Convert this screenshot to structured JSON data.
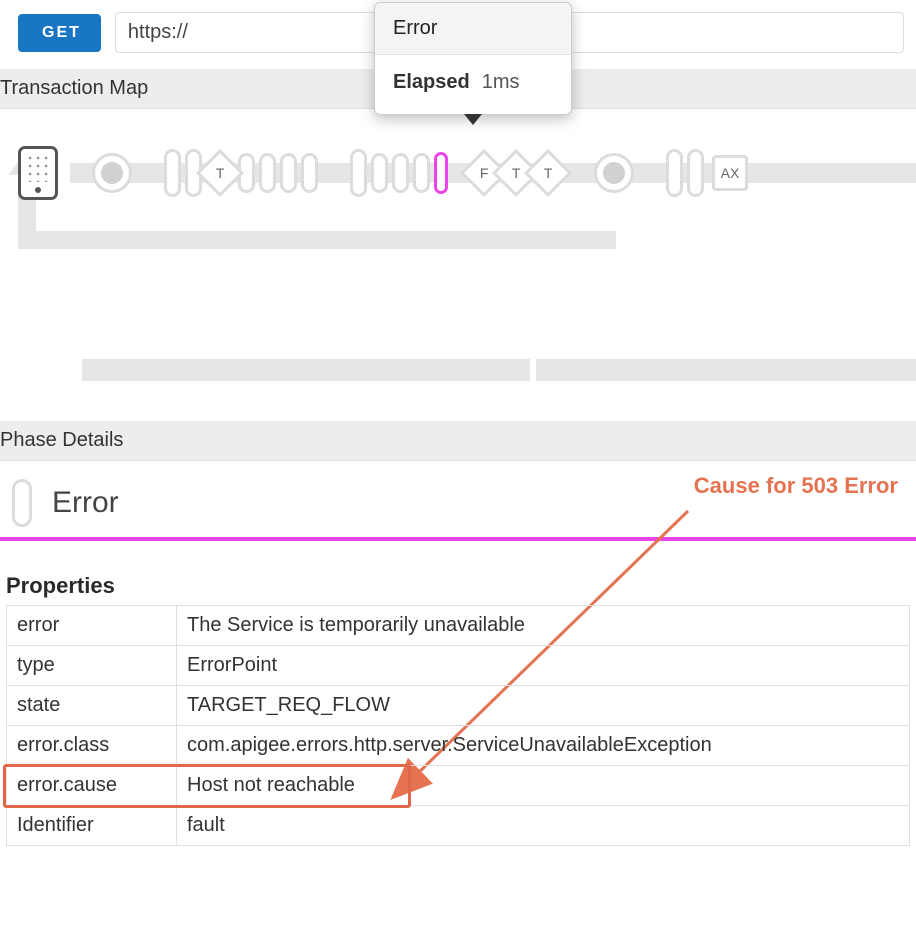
{
  "request": {
    "method": "GET",
    "url_prefix": "https://"
  },
  "tooltip": {
    "title": "Error",
    "label": "Elapsed",
    "value": "1ms"
  },
  "sections": {
    "transaction_map": "Transaction Map",
    "phase_details": "Phase Details"
  },
  "map": {
    "diamond1": "T",
    "diamond_f": "F",
    "diamond_t1": "T",
    "diamond_t2": "T",
    "box_ax": "AX"
  },
  "phase": {
    "title": "Error"
  },
  "annotation": "Cause for 503 Error",
  "properties_heading": "Properties",
  "properties": [
    {
      "k": "error",
      "v": "The Service is temporarily unavailable"
    },
    {
      "k": "type",
      "v": "ErrorPoint"
    },
    {
      "k": "state",
      "v": "TARGET_REQ_FLOW"
    },
    {
      "k": "error.class",
      "v": "com.apigee.errors.http.server.ServiceUnavailableException"
    },
    {
      "k": "error.cause",
      "v": "Host not reachable"
    },
    {
      "k": "Identifier",
      "v": "fault"
    }
  ],
  "highlight_row": 4
}
